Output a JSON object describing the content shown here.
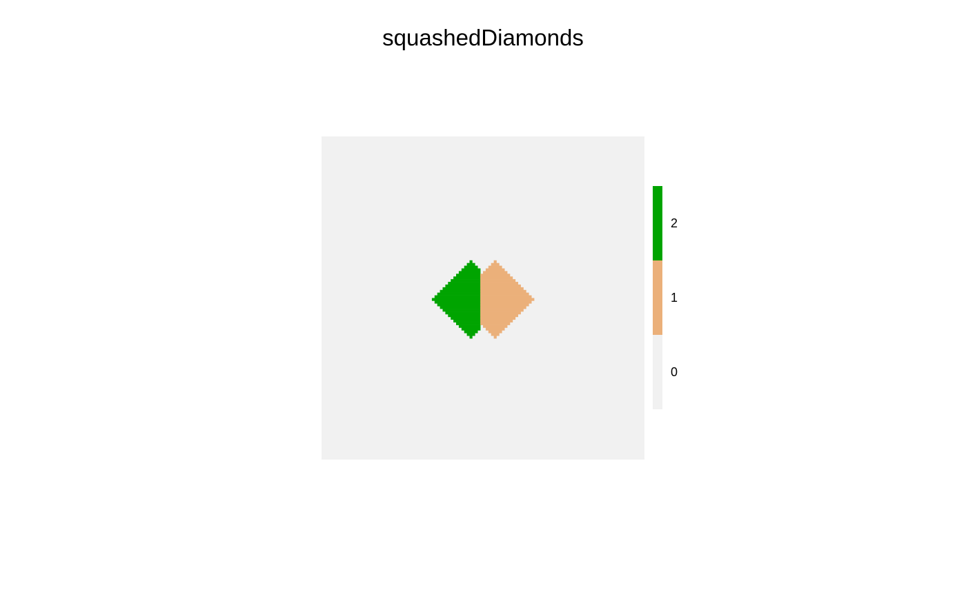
{
  "chart_data": {
    "type": "heatmap",
    "title": "squashedDiamonds",
    "grid": false,
    "colors": {
      "0": "#f1f1f1",
      "1": "#ebb07a",
      "2": "#00a400"
    },
    "legend": {
      "position": "right",
      "levels": [
        {
          "value": 2,
          "label": "2",
          "color": "#00a400"
        },
        {
          "value": 1,
          "label": "1",
          "color": "#ebb07a"
        },
        {
          "value": 0,
          "label": "0",
          "color": "#f1f1f1"
        }
      ]
    },
    "grid_size": [
      120,
      120
    ],
    "shapes": [
      {
        "value": 2,
        "shape": "diamond",
        "center": [
          55,
          60
        ],
        "radius": 14,
        "clip": "x<59"
      },
      {
        "value": 1,
        "shape": "diamond",
        "center": [
          64,
          60
        ],
        "radius": 14,
        "clip": "x>=59"
      }
    ]
  }
}
